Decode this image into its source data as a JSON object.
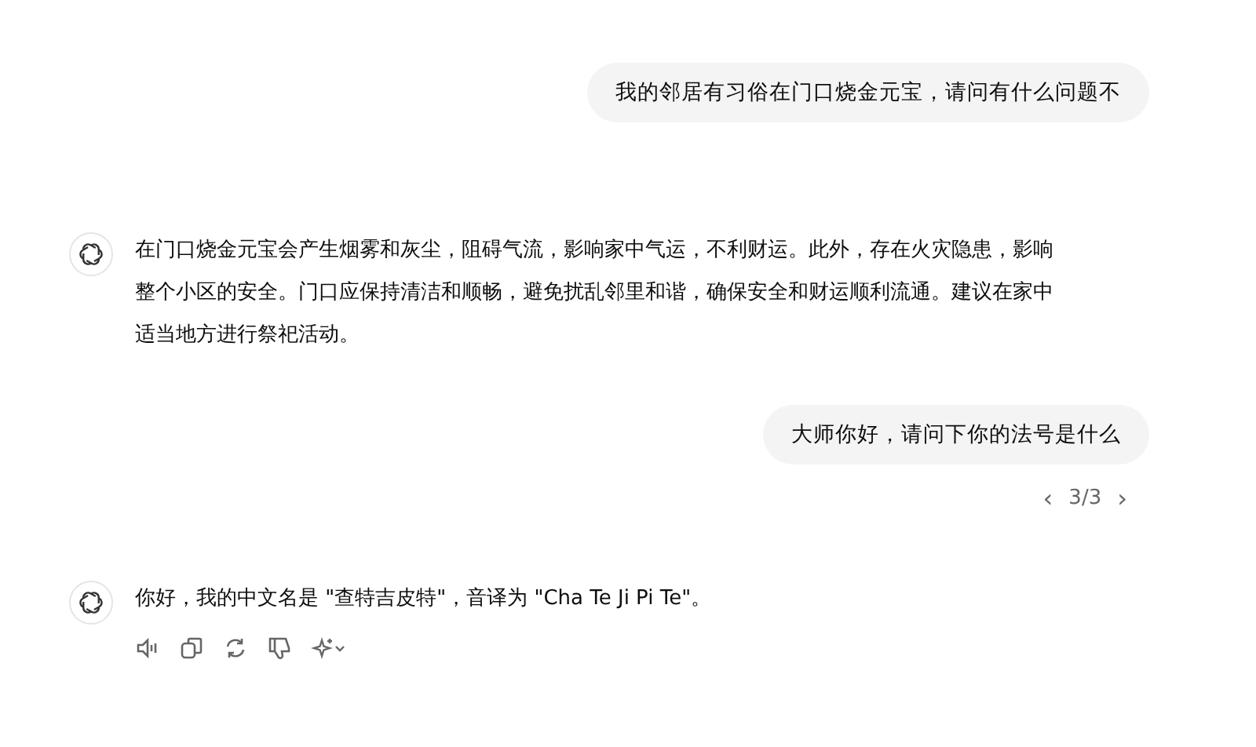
{
  "messages": [
    {
      "kind": "user",
      "text": "我的邻居有习俗在门口烧金元宝，请问有什么问题不"
    },
    {
      "kind": "assistant",
      "text": "在门口烧金元宝会产生烟雾和灰尘，阻碍气流，影响家中气运，不利财运。此外，存在火灾隐患，影响整个小区的安全。门口应保持清洁和顺畅，避免扰乱邻里和谐，确保安全和财运顺利流通。建议在家中适当地方进行祭祀活动。"
    },
    {
      "kind": "user",
      "text": "大师你好，请问下你的法号是什么",
      "pager": {
        "prev": "‹",
        "count": "3/3",
        "next": "›"
      }
    },
    {
      "kind": "assistant",
      "text": "你好，我的中文名是 \"查特吉皮特\"，音译为 \"Cha Te Ji Pi Te\"。",
      "actions": true
    }
  ]
}
